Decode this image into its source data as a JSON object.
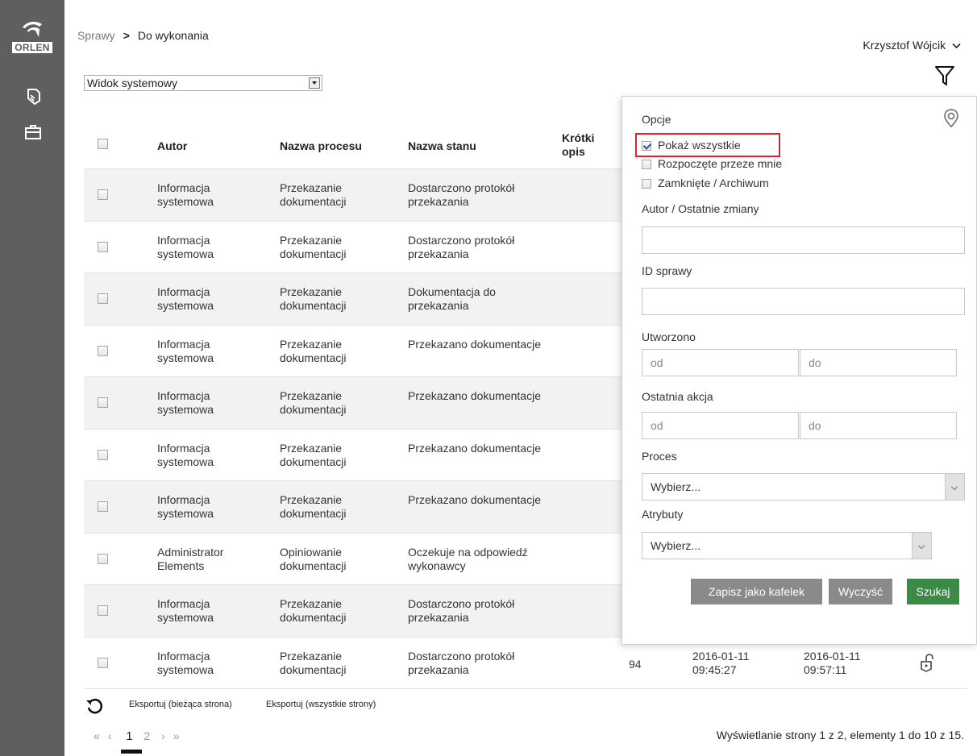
{
  "sidebar": {
    "logo_text": "ORLEN",
    "icons": [
      "documents-icon",
      "briefcase-icon"
    ]
  },
  "breadcrumb": {
    "root": "Sprawy",
    "separator": ">",
    "current": "Do wykonania"
  },
  "user": {
    "name": "Krzysztof Wójcik"
  },
  "view_select": {
    "value": "Widok systemowy"
  },
  "table": {
    "headers": {
      "autor": "Autor",
      "proces": "Nazwa procesu",
      "stan": "Nazwa stanu",
      "opis": "Krótki opis"
    },
    "rows": [
      {
        "autor": "Informacja systemowa",
        "proces": "Przekazanie dokumentacji",
        "stan": "Dostarczono protokół przekazania"
      },
      {
        "autor": "Informacja systemowa",
        "proces": "Przekazanie dokumentacji",
        "stan": "Dostarczono protokół przekazania"
      },
      {
        "autor": "Informacja systemowa",
        "proces": "Przekazanie dokumentacji",
        "stan": "Dokumentacja do przekazania"
      },
      {
        "autor": "Informacja systemowa",
        "proces": "Przekazanie dokumentacji",
        "stan": "Przekazano dokumentacje"
      },
      {
        "autor": "Informacja systemowa",
        "proces": "Przekazanie dokumentacji",
        "stan": "Przekazano dokumentacje"
      },
      {
        "autor": "Informacja systemowa",
        "proces": "Przekazanie dokumentacji",
        "stan": "Przekazano dokumentacje"
      },
      {
        "autor": "Informacja systemowa",
        "proces": "Przekazanie dokumentacji",
        "stan": "Przekazano dokumentacje"
      },
      {
        "autor": "Administrator Elements",
        "proces": "Opiniowanie dokumentacji",
        "stan": "Oczekuje na odpowiedź wykonawcy"
      },
      {
        "autor": "Informacja systemowa",
        "proces": "Przekazanie dokumentacji",
        "stan": "Dostarczono protokół przekazania"
      },
      {
        "autor": "Informacja systemowa",
        "proces": "Przekazanie dokumentacji",
        "stan": "Dostarczono protokół przekazania",
        "id": "94",
        "created": "2016-01-11 09:45:27",
        "last_action": "2016-01-11 09:57:11"
      }
    ]
  },
  "footer": {
    "export_current": "Eksportuj (bieżąca strona)",
    "export_all": "Eksportuj (wszystkie strony)",
    "pager": {
      "first": "«",
      "prev": "‹",
      "pages": [
        "1",
        "2"
      ],
      "next": "›",
      "last": "»",
      "current": "1"
    },
    "page_info": "Wyświetlanie strony 1 z 2, elementy 1 do 10 z 15."
  },
  "filter_panel": {
    "options_label": "Opcje",
    "options": [
      {
        "label": "Pokaż wszystkie",
        "checked": true
      },
      {
        "label": "Rozpoczęte przeze mnie",
        "checked": false
      },
      {
        "label": "Zamknięte / Archiwum",
        "checked": false
      }
    ],
    "author_label": "Autor / Ostatnie zmiany",
    "case_id_label": "ID sprawy",
    "created_label": "Utworzono",
    "last_action_label": "Ostatnia akcja",
    "from_placeholder": "od",
    "to_placeholder": "do",
    "process_label": "Proces",
    "process_value": "Wybierz...",
    "attributes_label": "Atrybuty",
    "attributes_value": "Wybierz...",
    "save_tile_button": "Zapisz jako kafelek",
    "clear_button": "Wyczyść",
    "search_button": "Szukaj"
  },
  "colors": {
    "sidebar": "#5f5f5f",
    "highlight": "#e0202b",
    "search_button": "#3b8a45",
    "secondary_button": "#8a8a8a"
  }
}
